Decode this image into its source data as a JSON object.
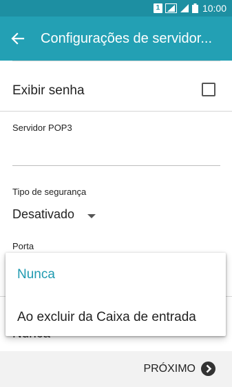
{
  "status_bar": {
    "time": "10:00",
    "sim_label": "1",
    "icons": [
      "sim-icon",
      "signal-icon",
      "signal-icon",
      "battery-icon"
    ]
  },
  "app_bar": {
    "title": "Configurações de servidor...",
    "back_icon": "arrow-left-icon"
  },
  "form": {
    "show_password_label": "Exibir senha",
    "show_password_checked": false,
    "pop3_server_label": "Servidor POP3",
    "pop3_server_value": "",
    "security_type_label": "Tipo de segurança",
    "security_type_value": "Desativado",
    "port_label": "Porta",
    "delete_label_obscured": "Nunca"
  },
  "dropdown": {
    "options": [
      {
        "label": "Nunca",
        "selected": true
      },
      {
        "label": "Ao excluir da Caixa de entrada",
        "selected": false
      }
    ]
  },
  "footer": {
    "next_label": "PRÓXIMO",
    "next_icon": "chevron-right-circle-icon"
  },
  "colors": {
    "status_bar": "#1d8fa2",
    "app_bar": "#23a0b4",
    "accent": "#1f9ab0"
  }
}
